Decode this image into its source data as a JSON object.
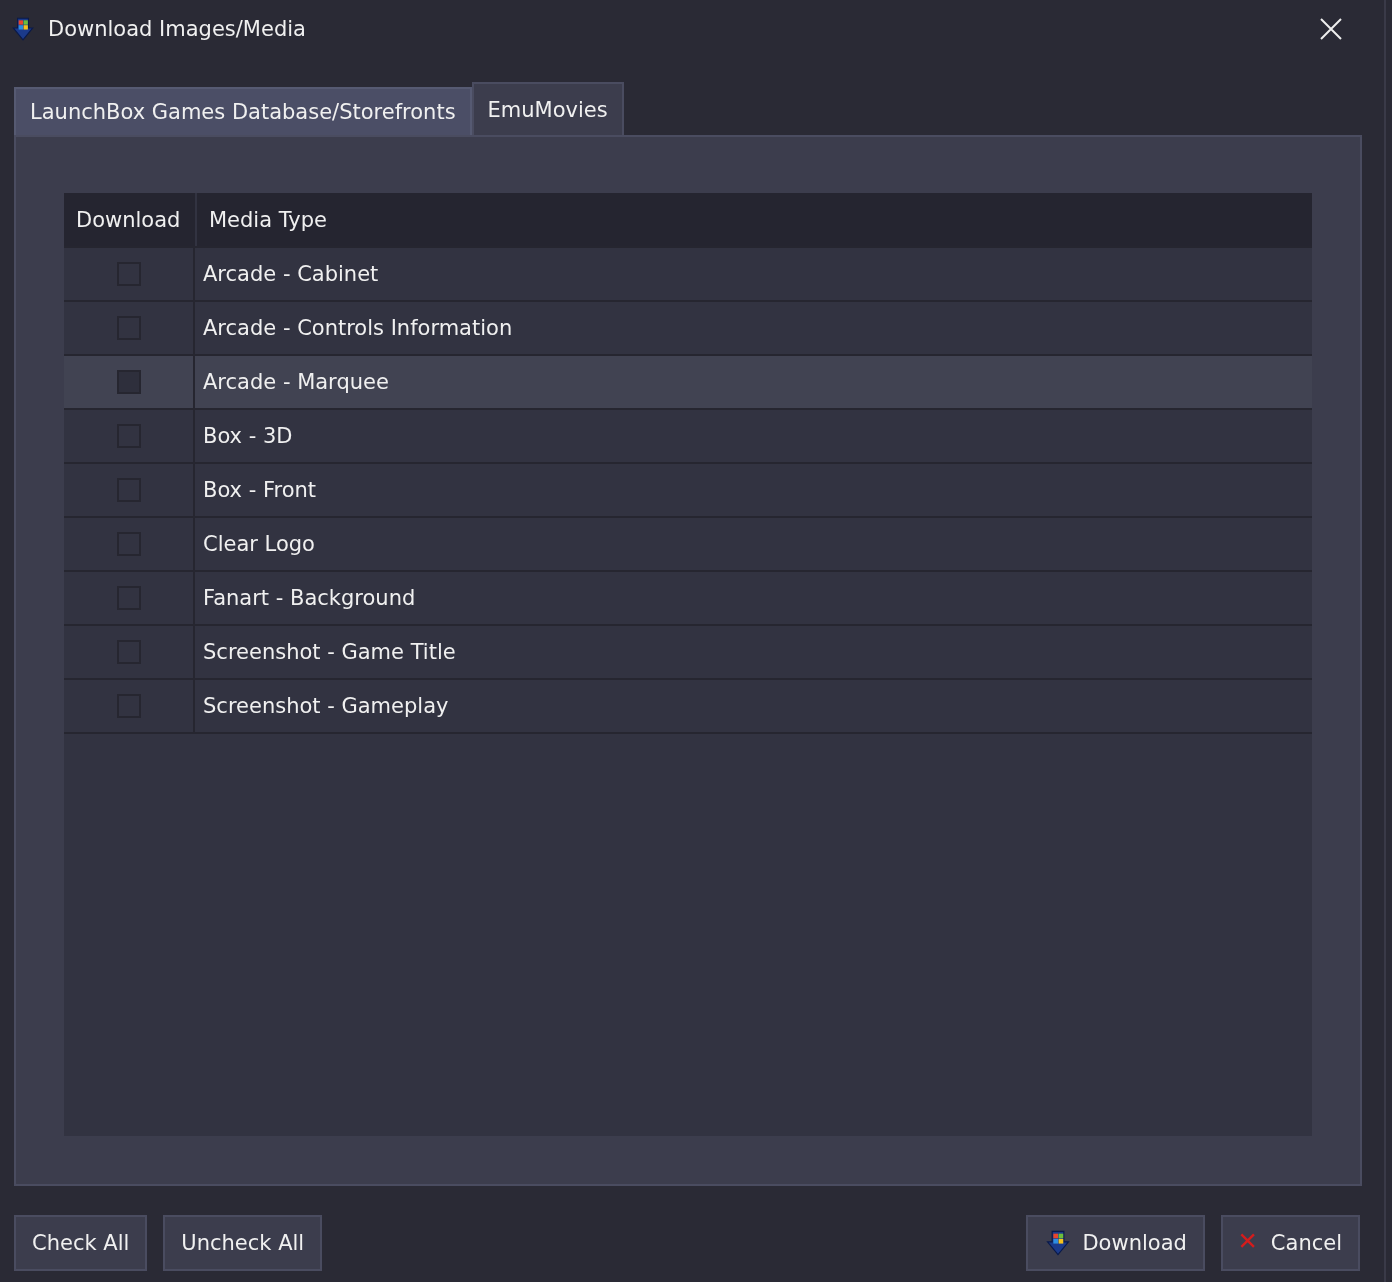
{
  "window": {
    "title": "Download Images/Media"
  },
  "tabs": [
    {
      "label": "LaunchBox Games Database/Storefronts",
      "selected": false
    },
    {
      "label": "EmuMovies",
      "selected": true
    }
  ],
  "table": {
    "columns": [
      "Download",
      "Media Type"
    ],
    "rows": [
      {
        "media_type": "Arcade - Cabinet",
        "checked": false,
        "selected": false
      },
      {
        "media_type": "Arcade - Controls Information",
        "checked": false,
        "selected": false
      },
      {
        "media_type": "Arcade - Marquee",
        "checked": false,
        "selected": true
      },
      {
        "media_type": "Box - 3D",
        "checked": false,
        "selected": false
      },
      {
        "media_type": "Box - Front",
        "checked": false,
        "selected": false
      },
      {
        "media_type": "Clear Logo",
        "checked": false,
        "selected": false
      },
      {
        "media_type": "Fanart - Background",
        "checked": false,
        "selected": false
      },
      {
        "media_type": "Screenshot - Game Title",
        "checked": false,
        "selected": false
      },
      {
        "media_type": "Screenshot - Gameplay",
        "checked": false,
        "selected": false
      }
    ]
  },
  "buttons": [
    {
      "label": "Check All",
      "kind": "plain"
    },
    {
      "label": "Uncheck All",
      "kind": "plain"
    },
    {
      "label": "Download",
      "kind": "download"
    },
    {
      "label": "Cancel",
      "kind": "cancel"
    }
  ]
}
